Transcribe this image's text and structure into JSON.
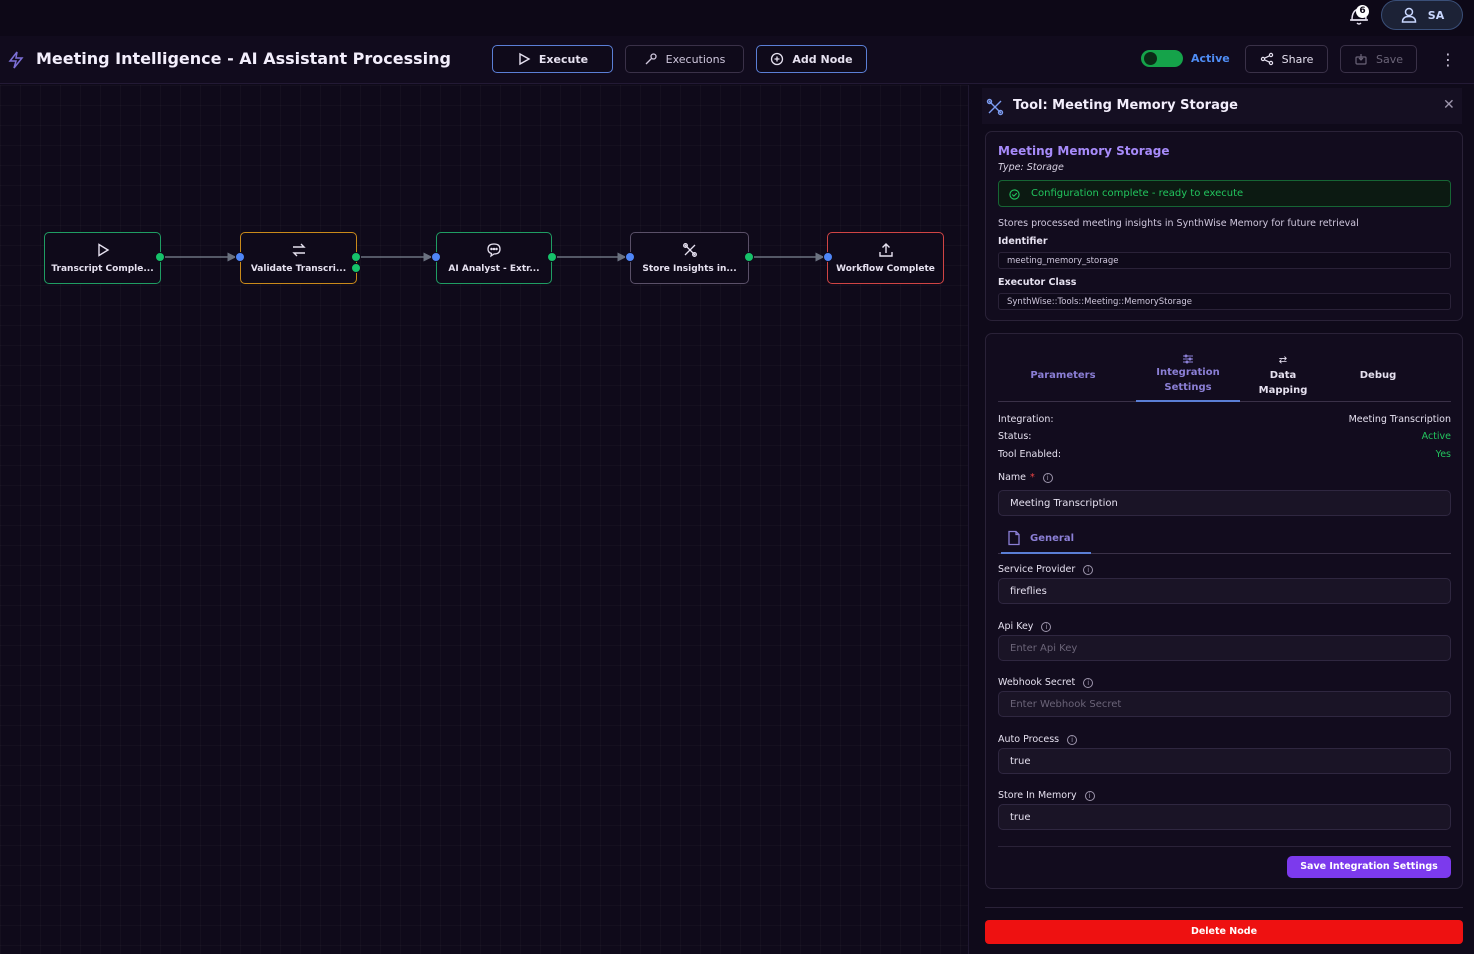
{
  "topbar": {
    "notification_count": "6",
    "user_initials": "SA"
  },
  "header": {
    "title": "Meeting Intelligence - AI Assistant Processing",
    "execute_label": "Execute",
    "executions_label": "Executions",
    "add_node_label": "Add Node",
    "active_label": "Active",
    "share_label": "Share",
    "save_label": "Save",
    "workflow_active": true
  },
  "workflow": {
    "nodes": [
      {
        "label": "Transcript Comple...",
        "icon": "play-icon",
        "border": "#1f9d63"
      },
      {
        "label": "Validate Transcri...",
        "icon": "swap-icon",
        "border": "#c98a1a"
      },
      {
        "label": "AI Analyst - Extr...",
        "icon": "chat-icon",
        "border": "#1f9d63"
      },
      {
        "label": "Store Insights in...",
        "icon": "tools-icon",
        "border": "#6b6478"
      },
      {
        "label": "Workflow Complete",
        "icon": "upload-icon",
        "border": "#d04444"
      }
    ]
  },
  "panel": {
    "title": "Tool: Meeting Memory Storage",
    "node_name": "Meeting Memory Storage",
    "node_type": "Type: Storage",
    "status_message": "Configuration complete - ready to execute",
    "description": "Stores processed meeting insights in SynthWise Memory for future retrieval",
    "identifier_label": "Identifier",
    "identifier_value": "meeting_memory_storage",
    "executor_label": "Executor Class",
    "executor_value": "SynthWise::Tools::Meeting::MemoryStorage",
    "tabs": {
      "parameters": "Parameters",
      "integration": "Integration Settings",
      "data_mapping": "Data Mapping",
      "debug": "Debug"
    },
    "integration_info": {
      "integration_label": "Integration:",
      "integration_value": "Meeting Transcription",
      "status_label": "Status:",
      "status_value": "Active",
      "tool_enabled_label": "Tool Enabled:",
      "tool_enabled_value": "Yes"
    },
    "name_label": "Name",
    "name_required": "*",
    "name_value": "Meeting Transcription",
    "general_tab": "General",
    "fields": {
      "service_provider_label": "Service Provider",
      "service_provider_value": "fireflies",
      "api_key_label": "Api Key",
      "api_key_placeholder": "Enter Api Key",
      "webhook_label": "Webhook Secret",
      "webhook_placeholder": "Enter Webhook Secret",
      "auto_process_label": "Auto Process",
      "auto_process_value": "true",
      "store_memory_label": "Store In Memory",
      "store_memory_value": "true"
    },
    "save_integration_label": "Save Integration Settings",
    "delete_label": "Delete Node"
  },
  "colors": {
    "accent": "#7c3aed",
    "success": "#22c55e",
    "danger": "#ee1111",
    "link": "#4f8df5"
  }
}
